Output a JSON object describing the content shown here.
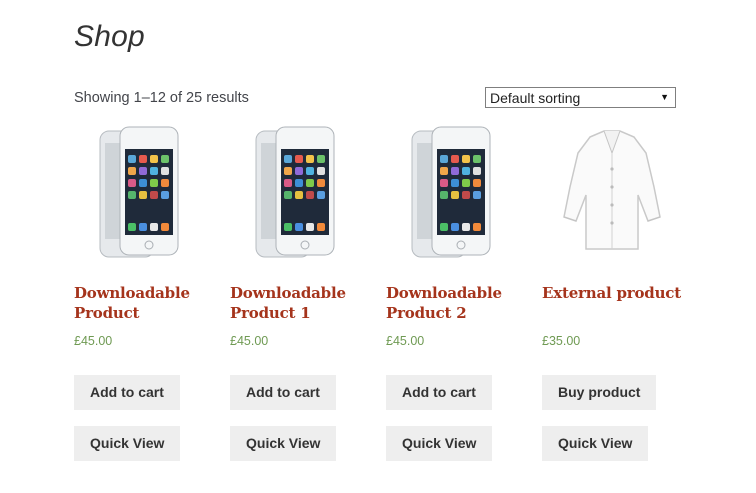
{
  "page": {
    "title": "Shop"
  },
  "toolbar": {
    "result_count": "Showing 1–12 of 25 results",
    "sorting_selected": "Default sorting"
  },
  "products": [
    {
      "name": "Downloadable Product",
      "price": "£45.00",
      "image": "iphone-image",
      "action_label": "Add to cart",
      "quick_view_label": "Quick View"
    },
    {
      "name": "Downloadable Product 1",
      "price": "£45.00",
      "image": "iphone-image",
      "action_label": "Add to cart",
      "quick_view_label": "Quick View"
    },
    {
      "name": "Downloadable Product 2",
      "price": "£45.00",
      "image": "iphone-image",
      "action_label": "Add to cart",
      "quick_view_label": "Quick View"
    },
    {
      "name": "External product",
      "price": "£35.00",
      "image": "white-shirt-image",
      "action_label": "Buy product",
      "quick_view_label": "Quick View"
    }
  ],
  "colors": {
    "product_title": "#a5341c",
    "price": "#6f9a53",
    "button_bg": "#eeeeee",
    "button_text": "#333333"
  }
}
